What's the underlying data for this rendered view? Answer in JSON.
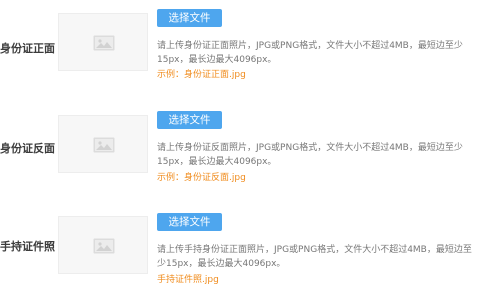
{
  "rows": [
    {
      "label": "身份证正面:",
      "button": "选择文件",
      "desc_line1": "请上传身份证正面照片，JPG或PNG格式，文件大小不超过4MB，最短边至少",
      "desc_line2": "15px，最长边最大4096px。",
      "example": "示例：身份证正面.jpg"
    },
    {
      "label": "身份证反面:",
      "button": "选择文件",
      "desc_line1": "请上传身份证反面照片，JPG或PNG格式，文件大小不超过4MB，最短边至少",
      "desc_line2": "15px，最长边最大4096px。",
      "example": "示例：身份证反面.jpg"
    },
    {
      "label": "手持证件照:",
      "button": "选择文件",
      "desc_line1": "请上传手持身份证正面照片，JPG或PNG格式，文件大小不超过4MB，最短边至",
      "desc_line2": "少15px，最长边最大4096px。",
      "example": "手持证件照.jpg"
    }
  ],
  "icons": {
    "placeholder": "image-placeholder-icon"
  },
  "colors": {
    "button": "#4ea6ee",
    "example_text": "#f08c1e",
    "label_text": "#3c3c3c"
  }
}
